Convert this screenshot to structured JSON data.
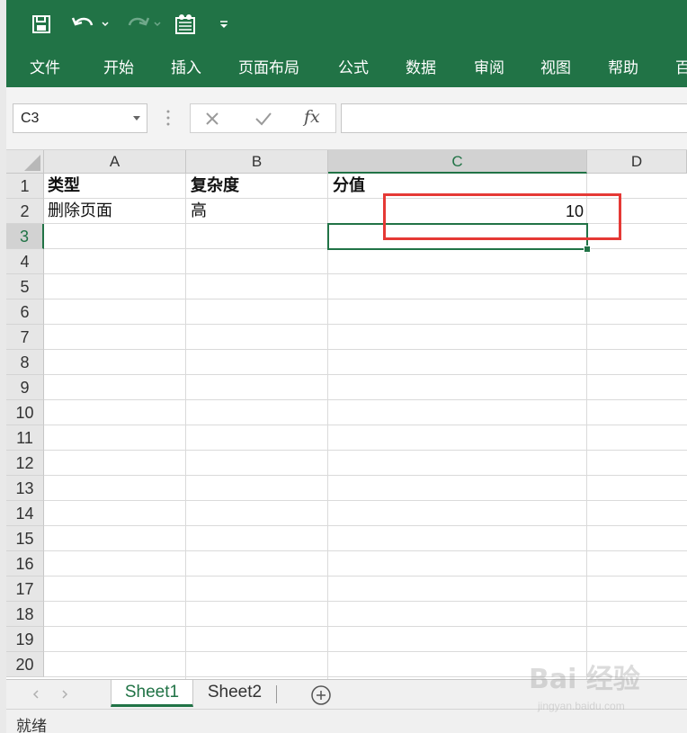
{
  "ribbon": {
    "tabs": [
      "文件",
      "开始",
      "插入",
      "页面布局",
      "公式",
      "数据",
      "审阅",
      "视图",
      "帮助",
      "百"
    ]
  },
  "formula_bar": {
    "name_box": "C3",
    "fx_label": "fx",
    "formula_value": ""
  },
  "columns": [
    "A",
    "B",
    "C",
    "D"
  ],
  "rows": [
    "1",
    "2",
    "3",
    "4",
    "5",
    "6",
    "7",
    "8",
    "9",
    "10",
    "11",
    "12",
    "13",
    "14",
    "15",
    "16",
    "17",
    "18",
    "19",
    "20"
  ],
  "cells": {
    "A1": "类型",
    "B1": "复杂度",
    "C1": "分值",
    "A2": "删除页面",
    "B2": "高",
    "C2": "10"
  },
  "active_cell": "C3",
  "sheets": [
    {
      "label": "Sheet1",
      "active": true
    },
    {
      "label": "Sheet2",
      "active": false
    }
  ],
  "status": {
    "text": "就绪"
  },
  "watermark": {
    "main": "Bai 经验",
    "sub": "jingyan.baidu.com"
  },
  "colors": {
    "excel_green": "#217346",
    "annotation_red": "#e53935"
  }
}
